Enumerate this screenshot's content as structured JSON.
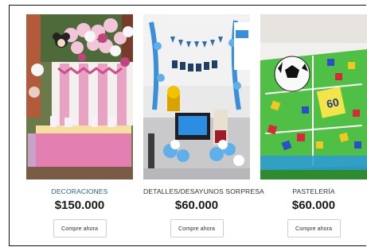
{
  "products": [
    {
      "title": "DECORACIONES",
      "price": "$150.000",
      "button": "Compre ahora",
      "image": "party-decoration-photo"
    },
    {
      "title": "DETALLES/DESAYUNOS SORPRESA",
      "price": "$60.000",
      "button": "Compre ahora",
      "image": "surprise-gift-photo"
    },
    {
      "title": "PASTELERÍA",
      "price": "$60.000",
      "button": "Compre ahora",
      "image": "soccer-cake-photo",
      "cake_sign": "60"
    }
  ]
}
